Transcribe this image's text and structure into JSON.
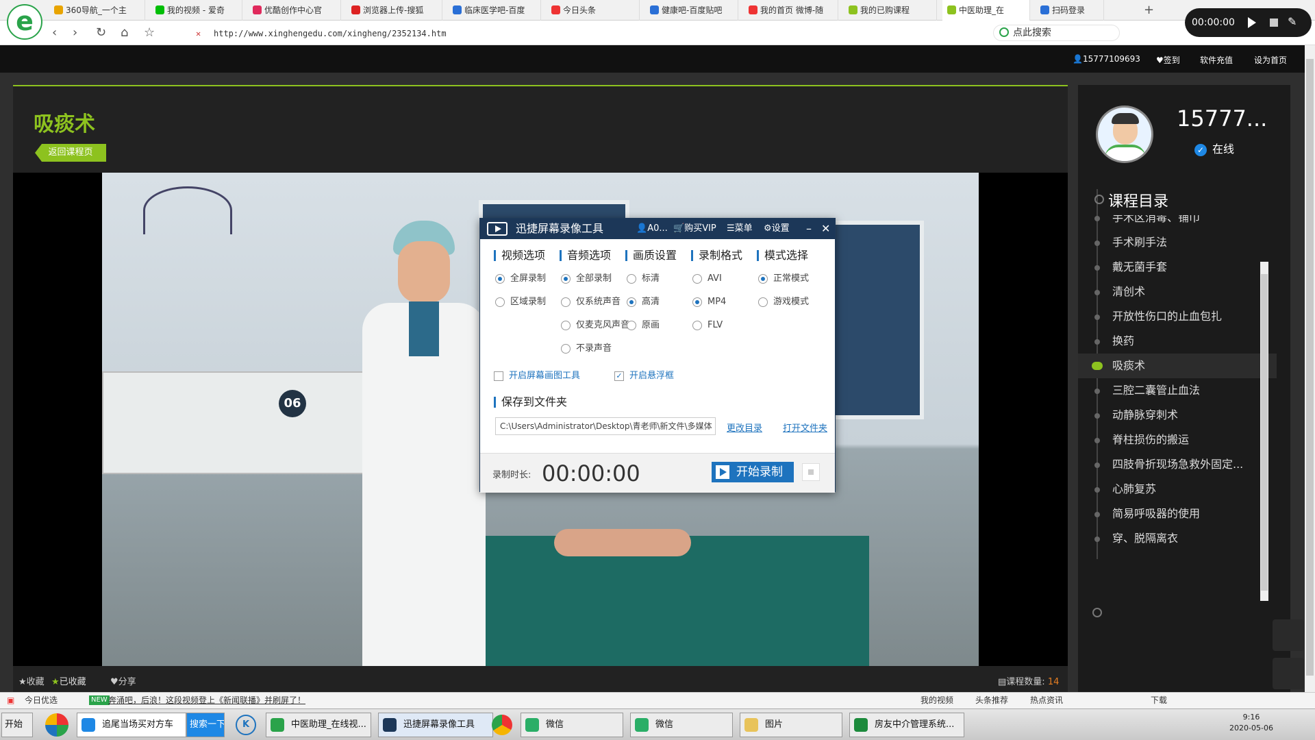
{
  "browser": {
    "tabs": [
      {
        "label": "360导航_一个主",
        "color": "#e8a400"
      },
      {
        "label": "我的视频 - 爱奇",
        "color": "#00be06"
      },
      {
        "label": "优酷创作中心官",
        "color": "#e02a5c"
      },
      {
        "label": "浏览器上传-搜狐",
        "color": "#d22"
      },
      {
        "label": "临床医学吧-百度",
        "color": "#2a6fd6"
      },
      {
        "label": "今日头条",
        "color": "#e33"
      },
      {
        "label": "健康吧-百度贴吧",
        "color": "#2a6fd6"
      },
      {
        "label": "我的首页 微博-随",
        "color": "#e33"
      },
      {
        "label": "我的已购课程",
        "color": "#8dc21f"
      },
      {
        "label": "中医助理_在",
        "color": "#8dc21f"
      },
      {
        "label": "扫码登录",
        "color": "#2a6fd6"
      }
    ],
    "url": "http://www.xinghengedu.com/xingheng/2352134.htm",
    "search_placeholder": "点此搜索"
  },
  "recorder_mini": {
    "time": "00:00:00"
  },
  "site": {
    "topbar": {
      "phone": "15777109693",
      "signin": "签到",
      "recharge": "软件充值",
      "homepage": "设为首页"
    },
    "course_title": "吸痰术",
    "back_label": "返回课程页",
    "footer": {
      "favorite": "收藏",
      "favorited": "已收藏",
      "share": "分享",
      "count_label": "课程数量:",
      "count": "14"
    },
    "user": {
      "name": "15777...",
      "status": "在线"
    },
    "catalog_title": "课程目录",
    "catalog": [
      {
        "label": "手术区消毒、铺巾",
        "active": false
      },
      {
        "label": "手术刷手法",
        "active": false
      },
      {
        "label": "戴无菌手套",
        "active": false
      },
      {
        "label": "清创术",
        "active": false
      },
      {
        "label": "开放性伤口的止血包扎",
        "active": false
      },
      {
        "label": "换药",
        "active": false
      },
      {
        "label": "吸痰术",
        "active": true
      },
      {
        "label": "三腔二囊管止血法",
        "active": false
      },
      {
        "label": "动静脉穿刺术",
        "active": false
      },
      {
        "label": "脊柱损伤的搬运",
        "active": false
      },
      {
        "label": "四肢骨折现场急救外固定...",
        "active": false
      },
      {
        "label": "心肺复苏",
        "active": false
      },
      {
        "label": "简易呼吸器的使用",
        "active": false
      },
      {
        "label": "穿、脱隔离衣",
        "active": false
      }
    ],
    "video_sign": "06"
  },
  "recorder": {
    "title": "迅捷屏幕录像工具",
    "account": "A0...",
    "buy_vip": "购买VIP",
    "menu": "菜单",
    "settings": "设置",
    "sections": {
      "video": {
        "title": "视频选项",
        "options": [
          {
            "label": "全屏录制",
            "on": true
          },
          {
            "label": "区域录制",
            "on": false
          }
        ]
      },
      "audio": {
        "title": "音频选项",
        "options": [
          {
            "label": "全部录制",
            "on": true
          },
          {
            "label": "仅系统声音",
            "on": false
          },
          {
            "label": "仅麦克风声音",
            "on": false
          },
          {
            "label": "不录声音",
            "on": false
          }
        ]
      },
      "quality": {
        "title": "画质设置",
        "options": [
          {
            "label": "标清",
            "on": false
          },
          {
            "label": "高清",
            "on": true
          },
          {
            "label": "原画",
            "on": false
          }
        ]
      },
      "format": {
        "title": "录制格式",
        "options": [
          {
            "label": "AVI",
            "on": false
          },
          {
            "label": "MP4",
            "on": true
          },
          {
            "label": "FLV",
            "on": false
          }
        ]
      },
      "mode": {
        "title": "模式选择",
        "options": [
          {
            "label": "正常模式",
            "on": true
          },
          {
            "label": "游戏模式",
            "on": false
          }
        ]
      }
    },
    "screenshot_tool": {
      "label": "开启屏幕画图工具",
      "checked": false
    },
    "float_box": {
      "label": "开启悬浮框",
      "checked": true
    },
    "save_title": "保存到文件夹",
    "path": "C:\\Users\\Administrator\\Desktop\\青老师\\新文件\\多媒体",
    "change_dir": "更改目录",
    "open_folder": "打开文件夹",
    "duration_label": "录制时长:",
    "duration": "00:00:00",
    "start_label": "开始录制"
  },
  "statusbar": {
    "left": "今日优选",
    "news": "奔涌吧，后浪！这段视频登上《新闻联播》并刷屏了！",
    "items": [
      "我的视频",
      "头条推荐",
      "热点资讯",
      "下载"
    ]
  },
  "taskbar": {
    "start": "开始",
    "search_text": "追尾当场买对方车",
    "search_btn": "搜索一下",
    "apps": [
      {
        "label": "中医助理_在线视...",
        "color": "#2aa34a"
      },
      {
        "label": "迅捷屏幕录像工具",
        "color": "#1c3758"
      },
      {
        "label": "微信",
        "color": "#2aae67"
      },
      {
        "label": "微信",
        "color": "#2aae67"
      },
      {
        "label": "图片",
        "color": "#e8c35a"
      },
      {
        "label": "房友中介管理系统...",
        "color": "#1c8a3c"
      }
    ],
    "time": "9:16",
    "date": "2020-05-06"
  }
}
